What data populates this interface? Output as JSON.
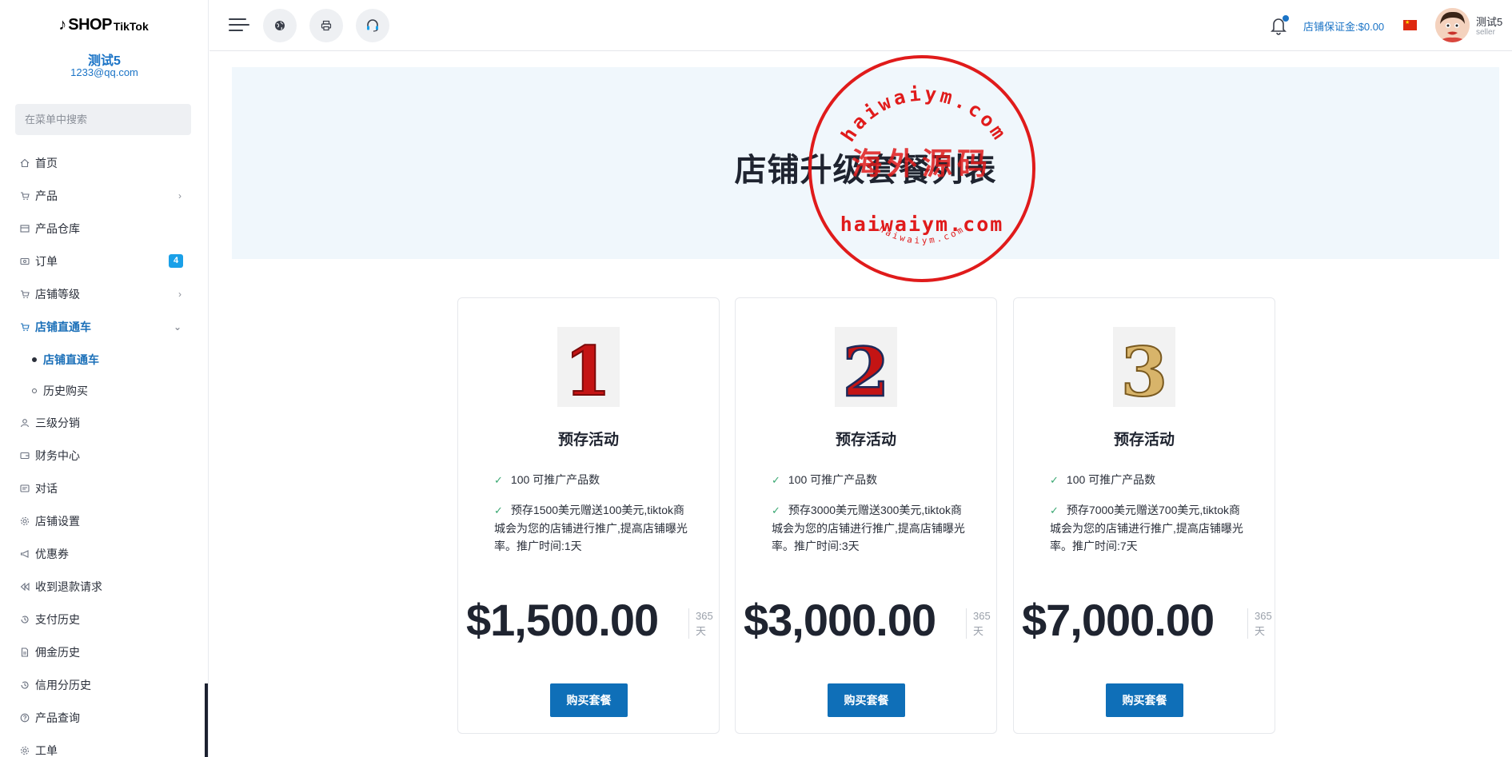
{
  "brand": {
    "logo_main": "SHOP",
    "logo_sub": "TikTok"
  },
  "user": {
    "name": "测试5",
    "email": "1233@qq.com",
    "role": "seller"
  },
  "search": {
    "placeholder": "在菜单中搜索"
  },
  "sidebar": {
    "items": [
      {
        "label": "首页",
        "icon": "home-icon"
      },
      {
        "label": "产品",
        "icon": "cart-icon",
        "chevron": "›"
      },
      {
        "label": "产品仓库",
        "icon": "warehouse-icon"
      },
      {
        "label": "订单",
        "icon": "order-icon",
        "badge": "4"
      },
      {
        "label": "店铺等级",
        "icon": "cart-icon",
        "chevron": "›"
      },
      {
        "label": "店铺直通车",
        "icon": "cart-icon",
        "chevron": "⌄"
      },
      {
        "label": "三级分销",
        "icon": "user-icon"
      },
      {
        "label": "财务中心",
        "icon": "wallet-icon"
      },
      {
        "label": "对话",
        "icon": "chat-icon"
      },
      {
        "label": "店铺设置",
        "icon": "gear-icon"
      },
      {
        "label": "优惠券",
        "icon": "megaphone-icon"
      },
      {
        "label": "收到退款请求",
        "icon": "rewind-icon"
      },
      {
        "label": "支付历史",
        "icon": "history-icon"
      },
      {
        "label": "佣金历史",
        "icon": "document-icon"
      },
      {
        "label": "信用分历史",
        "icon": "history-icon"
      },
      {
        "label": "产品查询",
        "icon": "question-icon"
      },
      {
        "label": "工单",
        "icon": "gear-icon"
      }
    ],
    "subitems": [
      {
        "label": "店铺直通车"
      },
      {
        "label": "历史购买"
      }
    ]
  },
  "topbar": {
    "deposit_label": "店铺保证金:",
    "deposit_value": "$0.00"
  },
  "hero": {
    "title": "店铺升级套餐列表"
  },
  "watermark": {
    "arc_text": "haiwaiym.com",
    "center_text": "海外源码",
    "url_text": "haiwaiym.com",
    "bottom_text": "haiwaiym.com"
  },
  "packages": [
    {
      "rank": "1",
      "title": "预存活动",
      "feature1": "100 可推广产品数",
      "feature2": "预存1500美元赠送100美元,tiktok商城会为您的店铺进行推广,提高店铺曝光率。推广时间:1天",
      "price": "$1,500.00",
      "period_num": "365",
      "period_unit": "天",
      "button": "购买套餐"
    },
    {
      "rank": "2",
      "title": "预存活动",
      "feature1": "100 可推广产品数",
      "feature2": "预存3000美元赠送300美元,tiktok商城会为您的店铺进行推广,提高店铺曝光率。推广时间:3天",
      "price": "$3,000.00",
      "period_num": "365",
      "period_unit": "天",
      "button": "购买套餐"
    },
    {
      "rank": "3",
      "title": "预存活动",
      "feature1": "100 可推广产品数",
      "feature2": "预存7000美元赠送700美元,tiktok商城会为您的店铺进行推广,提高店铺曝光率。推广时间:7天",
      "price": "$7,000.00",
      "period_num": "365",
      "period_unit": "天",
      "button": "购买套餐"
    }
  ],
  "colors": {
    "accent": "#1a73c6",
    "button": "#0f6fb8",
    "stamp": "#e01b1b",
    "hero_bg": "#f0f7fc"
  }
}
